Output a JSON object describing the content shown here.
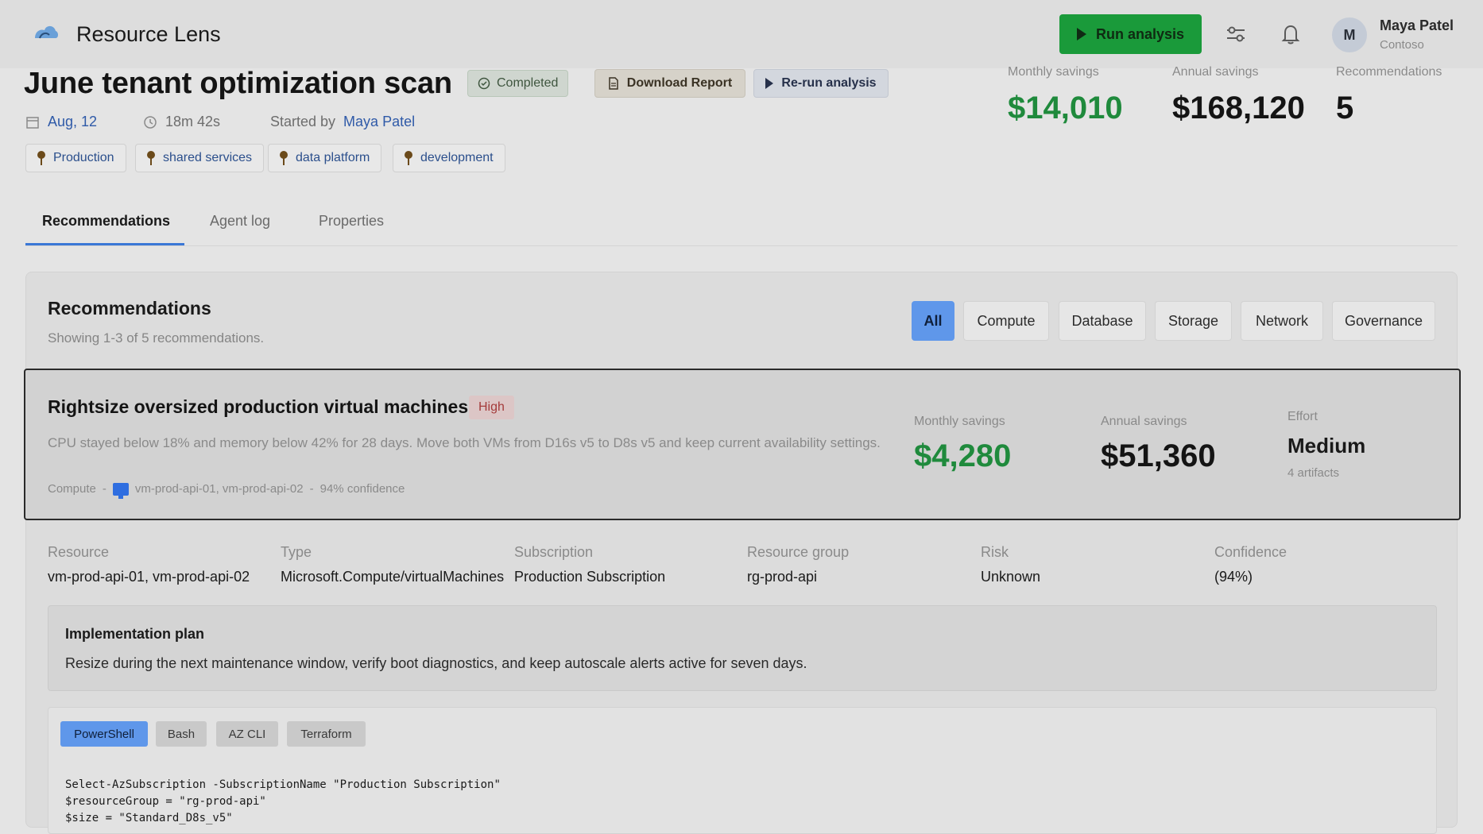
{
  "app": {
    "title": "Resource Lens"
  },
  "header": {
    "run_label": "Run analysis",
    "user": {
      "initial": "M",
      "name": "Maya Patel",
      "org": "Contoso"
    }
  },
  "scan": {
    "title": "June tenant optimization scan",
    "status": "Completed",
    "download_label": "Download Report",
    "rerun_label": "Re-run analysis",
    "date": "Aug, 12",
    "duration": "18m 42s",
    "started_by_prefix": "Started by",
    "started_by": "Maya Patel",
    "tags": [
      "Production",
      "shared services",
      "data platform",
      "development"
    ]
  },
  "kpis": {
    "monthly_label": "Monthly savings",
    "monthly_value": "$14,010",
    "annual_label": "Annual savings",
    "annual_value": "$168,120",
    "recs_label": "Recommendations",
    "recs_value": "5"
  },
  "tabs": [
    "Recommendations",
    "Agent log",
    "Properties"
  ],
  "recommendations": {
    "title": "Recommendations",
    "subtitle": "Showing 1-3 of 5 recommendations.",
    "filters": [
      "All",
      "Compute",
      "Database",
      "Storage",
      "Network",
      "Governance"
    ]
  },
  "card": {
    "title": "Rightsize oversized production virtual machines",
    "priority": "High",
    "description": "CPU stayed below 18% and memory below 42% for 28 days. Move both VMs from D16s v5 to D8s v5 and keep current availability settings.",
    "category": "Compute",
    "sep": "-",
    "resources": "vm-prod-api-01, vm-prod-api-02",
    "confidence": "94% confidence",
    "monthly_label": "Monthly savings",
    "monthly_value": "$4,280",
    "annual_label": "Annual savings",
    "annual_value": "$51,360",
    "effort_label": "Effort",
    "effort_value": "Medium",
    "artifacts": "4 artifacts"
  },
  "details": {
    "labels": {
      "resource": "Resource",
      "type": "Type",
      "subscription": "Subscription",
      "rg": "Resource group",
      "risk": "Risk",
      "confidence": "Confidence"
    },
    "values": {
      "resource": "vm-prod-api-01, vm-prod-api-02",
      "type": "Microsoft.Compute/virtualMachines",
      "subscription": "Production Subscription",
      "rg": "rg-prod-api",
      "risk": "Unknown",
      "confidence": "(94%)"
    }
  },
  "plan": {
    "title": "Implementation plan",
    "text": "Resize during the next maintenance window, verify boot diagnostics, and keep autoscale alerts active for seven days."
  },
  "code": {
    "languages": [
      "PowerShell",
      "Bash",
      "AZ CLI",
      "Terraform"
    ],
    "text": "Select-AzSubscription -SubscriptionName \"Production Subscription\"\n$resourceGroup = \"rg-prod-api\"\n$size = \"Standard_D8s_v5\""
  },
  "colors": {
    "accent": "#5f97ea",
    "success": "#1a9a3a",
    "savings": "#1f8a3c",
    "priority_high": "#a43b3b"
  }
}
